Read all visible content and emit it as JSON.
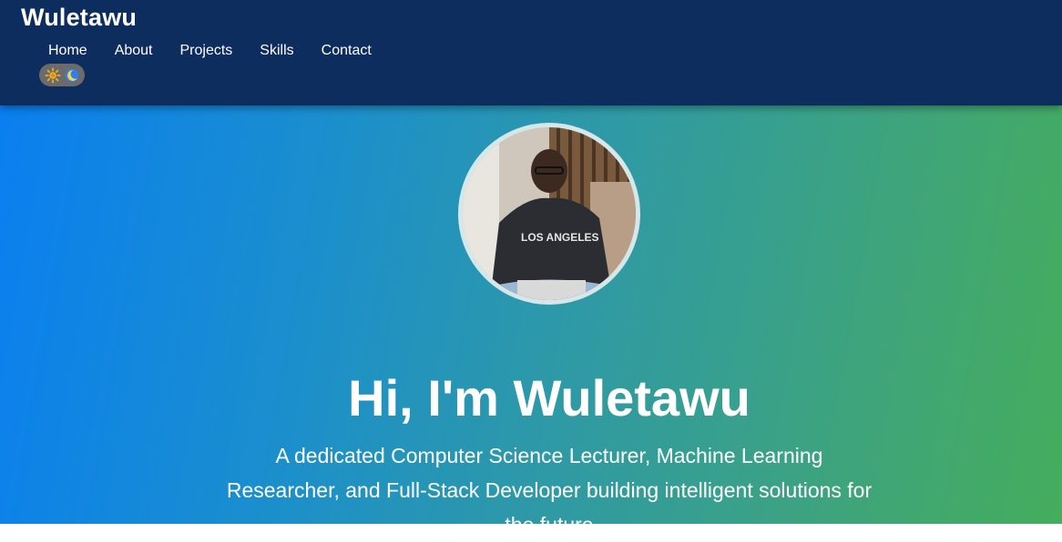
{
  "header": {
    "brand": "Wuletawu",
    "nav": [
      {
        "label": "Home"
      },
      {
        "label": "About"
      },
      {
        "label": "Projects"
      },
      {
        "label": "Skills"
      },
      {
        "label": "Contact"
      }
    ],
    "theme_toggle": {
      "icons": [
        "sun-icon",
        "moon-icon"
      ]
    }
  },
  "hero": {
    "avatar": "profile-photo",
    "title": "Hi, I'm Wuletawu",
    "subtitle": "A dedicated Computer Science Lecturer, Machine Learning Researcher, and Full-Stack Developer building intelligent solutions for the future"
  },
  "colors": {
    "header_bg": "#0d2d5e",
    "gradient_start": "#0a7ff0",
    "gradient_end": "#45ad5c"
  }
}
